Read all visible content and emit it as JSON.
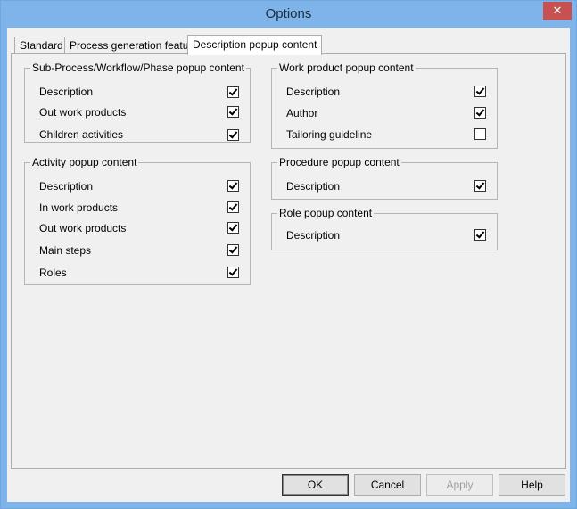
{
  "window": {
    "title": "Options",
    "close_glyph": "✕"
  },
  "tabs": [
    {
      "label": "Standard",
      "active": false
    },
    {
      "label": "Process generation feature",
      "active": false
    },
    {
      "label": "Description popup content",
      "active": true
    }
  ],
  "groups": {
    "subprocess": {
      "title": "Sub-Process/Workflow/Phase popup content",
      "items": [
        {
          "label": "Description",
          "checked": true
        },
        {
          "label": "Out work products",
          "checked": true
        },
        {
          "label": "Children activities",
          "checked": true
        }
      ]
    },
    "activity": {
      "title": "Activity popup content",
      "items": [
        {
          "label": "Description",
          "checked": true
        },
        {
          "label": "In work products",
          "checked": true
        },
        {
          "label": "Out work products",
          "checked": true
        },
        {
          "label": "Main steps",
          "checked": true
        },
        {
          "label": "Roles",
          "checked": true
        }
      ]
    },
    "workproduct": {
      "title": "Work product popup content",
      "items": [
        {
          "label": "Description",
          "checked": true
        },
        {
          "label": "Author",
          "checked": true
        },
        {
          "label": "Tailoring guideline",
          "checked": false
        }
      ]
    },
    "procedure": {
      "title": "Procedure popup content",
      "items": [
        {
          "label": "Description",
          "checked": true
        }
      ]
    },
    "role": {
      "title": "Role popup content",
      "items": [
        {
          "label": "Description",
          "checked": true
        }
      ]
    }
  },
  "buttons": {
    "ok": "OK",
    "cancel": "Cancel",
    "apply": "Apply",
    "help": "Help"
  }
}
